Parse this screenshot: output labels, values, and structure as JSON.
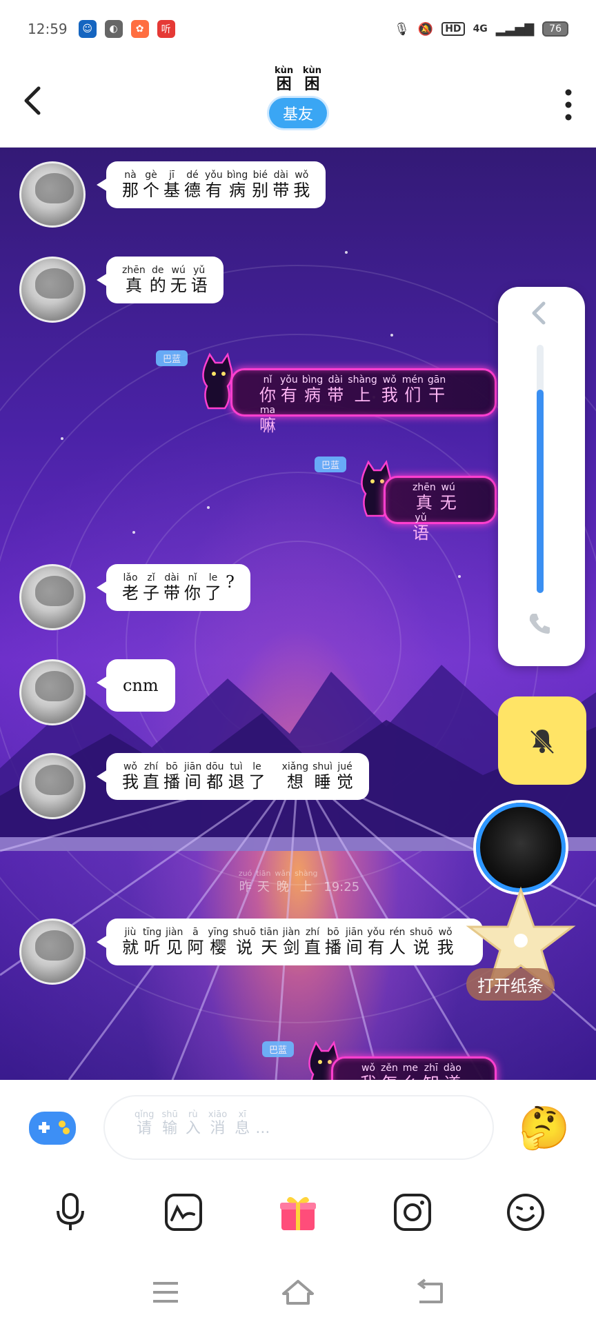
{
  "status_bar": {
    "time": "12:59",
    "battery": "76",
    "network": "4G",
    "hd": "HD",
    "app_icons": [
      "app-icon-1",
      "app-icon-2",
      "app-icon-3",
      "听"
    ]
  },
  "header": {
    "title_chars": [
      {
        "py": "kùn",
        "hz": "困"
      },
      {
        "py": "kùn",
        "hz": "困"
      }
    ],
    "badge": "基友"
  },
  "messages": [
    {
      "side": "left",
      "chars": [
        {
          "py": "nà",
          "hz": "那"
        },
        {
          "py": "gè",
          "hz": "个"
        },
        {
          "py": "jī",
          "hz": "基"
        },
        {
          "py": "dé",
          "hz": "德"
        },
        {
          "py": "yǒu",
          "hz": "有"
        },
        {
          "py": "bìng",
          "hz": "病"
        },
        {
          "py": "bié",
          "hz": "别"
        },
        {
          "py": "dài",
          "hz": "带"
        },
        {
          "py": "wǒ",
          "hz": "我"
        }
      ]
    },
    {
      "side": "left",
      "chars": [
        {
          "py": "zhēn",
          "hz": "真"
        },
        {
          "py": "de",
          "hz": "的"
        },
        {
          "py": "wú",
          "hz": "无"
        },
        {
          "py": "yǔ",
          "hz": "语"
        }
      ]
    },
    {
      "side": "right",
      "tag": "巴蓝",
      "chars": [
        {
          "py": "nǐ",
          "hz": "你"
        },
        {
          "py": "yǒu",
          "hz": "有"
        },
        {
          "py": "bìng",
          "hz": "病"
        },
        {
          "py": "dài",
          "hz": "带"
        },
        {
          "py": "shàng",
          "hz": "上"
        },
        {
          "py": "wǒ",
          "hz": "我"
        },
        {
          "py": "mén",
          "hz": "们"
        },
        {
          "py": "gān",
          "hz": "干"
        },
        {
          "py": "ma",
          "hz": "嘛"
        }
      ]
    },
    {
      "side": "right",
      "tag": "巴蓝",
      "chars": [
        {
          "py": "zhēn",
          "hz": "真"
        },
        {
          "py": "wú",
          "hz": "无"
        },
        {
          "py": "yǔ",
          "hz": "语"
        }
      ]
    },
    {
      "side": "left",
      "chars": [
        {
          "py": "lǎo",
          "hz": "老"
        },
        {
          "py": "zǐ",
          "hz": "子"
        },
        {
          "py": "dài",
          "hz": "带"
        },
        {
          "py": "nǐ",
          "hz": "你"
        },
        {
          "py": "le",
          "hz": "了"
        },
        {
          "py": "",
          "hz": "?"
        }
      ]
    },
    {
      "side": "left",
      "text": "cnm"
    },
    {
      "side": "left",
      "chars": [
        {
          "py": "wǒ",
          "hz": "我"
        },
        {
          "py": "zhí",
          "hz": "直"
        },
        {
          "py": "bō",
          "hz": "播"
        },
        {
          "py": "jiān",
          "hz": "间"
        },
        {
          "py": "dōu",
          "hz": "都"
        },
        {
          "py": "tuì",
          "hz": "退"
        },
        {
          "py": "le",
          "hz": "了"
        },
        {
          "py": "",
          "hz": " "
        },
        {
          "py": "xiǎng",
          "hz": "想"
        },
        {
          "py": "shuì",
          "hz": "睡"
        },
        {
          "py": "jué",
          "hz": "觉"
        }
      ]
    },
    {
      "side": "left",
      "chars": [
        {
          "py": "jiù",
          "hz": "就"
        },
        {
          "py": "tīng",
          "hz": "听"
        },
        {
          "py": "jiàn",
          "hz": "见"
        },
        {
          "py": "ā",
          "hz": "阿"
        },
        {
          "py": "yīng",
          "hz": "樱"
        },
        {
          "py": "shuō",
          "hz": "说"
        },
        {
          "py": "tiān",
          "hz": "天"
        },
        {
          "py": "jiàn",
          "hz": "剑"
        },
        {
          "py": "zhí",
          "hz": "直"
        },
        {
          "py": "bō",
          "hz": "播"
        },
        {
          "py": "jiān",
          "hz": "间"
        },
        {
          "py": "yǒu",
          "hz": "有"
        },
        {
          "py": "rén",
          "hz": "人"
        },
        {
          "py": "shuō",
          "hz": "说"
        },
        {
          "py": "wǒ",
          "hz": "我"
        }
      ]
    },
    {
      "side": "right",
      "tag": "巴蓝",
      "chars": [
        {
          "py": "wǒ",
          "hz": "我"
        },
        {
          "py": "zěn",
          "hz": "怎"
        },
        {
          "py": "me",
          "hz": "么"
        },
        {
          "py": "zhī",
          "hz": "知"
        },
        {
          "py": "dào",
          "hz": "道"
        }
      ]
    }
  ],
  "timestamp": {
    "chars": [
      {
        "py": "zuó",
        "hz": "昨"
      },
      {
        "py": "tiān",
        "hz": "天"
      },
      {
        "py": "wǎn",
        "hz": "晚"
      },
      {
        "py": "shàng",
        "hz": "上"
      }
    ],
    "time": "19:25"
  },
  "side_panel": {
    "volume_level": 0.82
  },
  "note_button": "打开纸条",
  "input": {
    "placeholder_chars": [
      {
        "py": "qǐng",
        "hz": "请"
      },
      {
        "py": "shū",
        "hz": "输"
      },
      {
        "py": "rù",
        "hz": "入"
      },
      {
        "py": "xiāo",
        "hz": "消"
      },
      {
        "py": "xī",
        "hz": "息"
      }
    ],
    "ellipsis": "..."
  },
  "colors": {
    "accent": "#3aa6f4",
    "neon": "#ff3fcf",
    "mute_bg": "#ffe466",
    "gift": "#ff4d7a"
  }
}
